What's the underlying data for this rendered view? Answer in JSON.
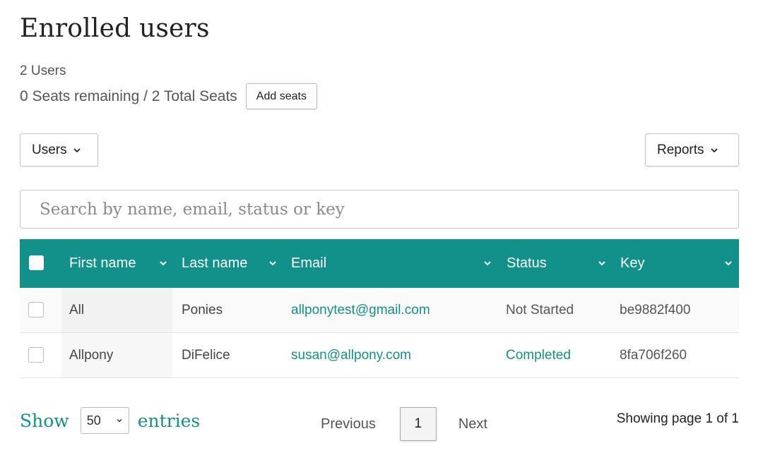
{
  "page": {
    "title": "Enrolled users",
    "user_count": "2 Users",
    "seats": "0 Seats remaining / 2 Total Seats",
    "add_seats_label": "Add seats"
  },
  "toolbar": {
    "users_label": "Users",
    "reports_label": "Reports"
  },
  "search": {
    "placeholder": "Search by name, email, status or key",
    "value": ""
  },
  "table": {
    "columns": [
      "First name",
      "Last name",
      "Email",
      "Status",
      "Key"
    ],
    "rows": [
      {
        "first": "All",
        "last": "Ponies",
        "email": "allponytest@gmail.com",
        "status": "Not Started",
        "key": "be9882f400"
      },
      {
        "first": "Allpony",
        "last": "DiFelice",
        "email": "susan@allpony.com",
        "status": "Completed",
        "key": "8fa706f260"
      }
    ]
  },
  "footer": {
    "show_label": "Show",
    "entries_value": "50",
    "entries_label": "entries",
    "previous_label": "Previous",
    "current_page": "1",
    "next_label": "Next",
    "page_info": "Showing page 1 of 1"
  },
  "colors": {
    "accent": "#12918a",
    "header_text": "#ffffff"
  },
  "icons": [
    "chevron-down-icon",
    "checkbox-icon"
  ]
}
